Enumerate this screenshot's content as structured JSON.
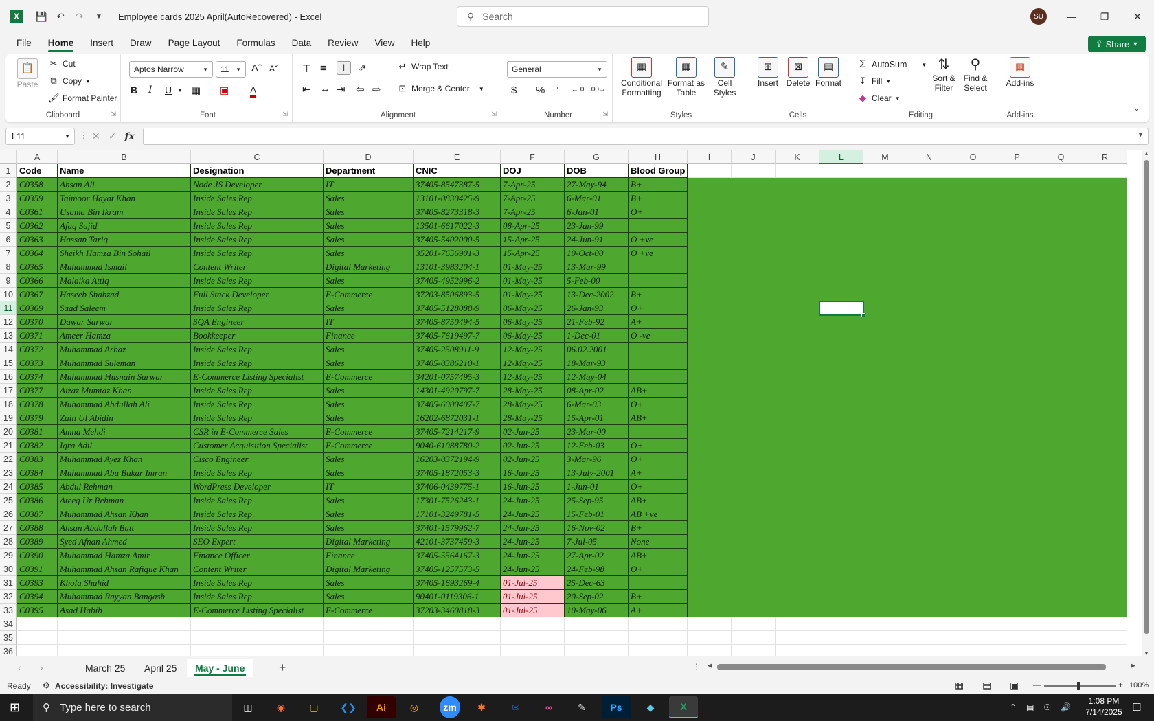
{
  "window": {
    "title": "Employee cards 2025 April(AutoRecovered)  -  Excel",
    "search_placeholder": "Search",
    "user_initials": "SU",
    "share_label": "Share"
  },
  "menu": [
    "File",
    "Home",
    "Insert",
    "Draw",
    "Page Layout",
    "Formulas",
    "Data",
    "Review",
    "View",
    "Help"
  ],
  "ribbon": {
    "clipboard": {
      "label": "Clipboard",
      "paste": "Paste",
      "cut": "Cut",
      "copy": "Copy",
      "format_painter": "Format Painter"
    },
    "font": {
      "label": "Font",
      "name": "Aptos Narrow",
      "size": "11",
      "bold": "B",
      "italic": "I",
      "underline": "U"
    },
    "alignment": {
      "label": "Alignment",
      "wrap": "Wrap Text",
      "merge": "Merge & Center"
    },
    "number": {
      "label": "Number",
      "format": "General"
    },
    "styles": {
      "label": "Styles",
      "conditional": "Conditional Formatting",
      "format_table": "Format as Table",
      "cell_styles": "Cell Styles"
    },
    "cells": {
      "label": "Cells",
      "insert": "Insert",
      "delete": "Delete",
      "format": "Format"
    },
    "editing": {
      "label": "Editing",
      "autosum": "AutoSum",
      "fill": "Fill",
      "clear": "Clear",
      "sort": "Sort & Filter",
      "find": "Find & Select"
    },
    "addins": {
      "label": "Add-ins",
      "addins": "Add-ins"
    }
  },
  "formula_bar": {
    "name_box": "L11",
    "fx": "fx",
    "value": ""
  },
  "columns": [
    "A",
    "B",
    "C",
    "D",
    "E",
    "F",
    "G",
    "H",
    "I",
    "J",
    "K",
    "L",
    "M",
    "N",
    "O",
    "P",
    "Q",
    "R"
  ],
  "headers": [
    "Code",
    "Name",
    "Designation",
    "Department",
    "CNIC",
    "DOJ",
    "DOB",
    "Blood Group"
  ],
  "rows": [
    [
      "C0358",
      "Ahsan Ali",
      "Node JS Developer",
      "IT",
      "37405-8547387-5",
      "7-Apr-25",
      "27-May-94",
      "B+"
    ],
    [
      "C0359",
      "Taimoor Hayat Khan",
      "Inside Sales Rep",
      "Sales",
      "13101-0830425-9",
      "7-Apr-25",
      "6-Mar-01",
      "B+"
    ],
    [
      "C0361",
      "Usama Bin Ikram",
      "Inside Sales Rep",
      "Sales",
      "37405-8273318-3",
      "7-Apr-25",
      "6-Jan-01",
      "O+"
    ],
    [
      "C0362",
      "Afaq Sajid",
      "Inside Sales Rep",
      "Sales",
      "13501-6617022-3",
      "08-Apr-25",
      "23-Jan-99",
      ""
    ],
    [
      "C0363",
      "Hassan Tariq",
      "Inside Sales Rep",
      "Sales",
      "37405-5402000-5",
      "15-Apr-25",
      "24-Jun-91",
      "O +ve"
    ],
    [
      "C0364",
      "Sheikh Hamza Bin Sohail",
      "Inside Sales Rep",
      "Sales",
      "35201-7656901-3",
      "15-Apr-25",
      "10-Oct-00",
      "O +ve"
    ],
    [
      "C0365",
      "Muhammad Ismail",
      "Content Writer",
      "Digital Marketing",
      "13101-3983204-1",
      "01-May-25",
      "13-Mar-99",
      ""
    ],
    [
      "C0366",
      "Malaika Attiq",
      "Inside Sales Rep",
      "Sales",
      "37405-4952996-2",
      "01-May-25",
      "5-Feb-00",
      ""
    ],
    [
      "C0367",
      "Haseeb Shahzad",
      "Full Stack Developer",
      "E-Commerce",
      "37203-8506893-5",
      "01-May-25",
      "13-Dec-2002",
      "B+"
    ],
    [
      "C0369",
      "Saad Saleem",
      "Inside Sales Rep",
      "Sales",
      "37405-5128088-9",
      "06-May-25",
      "26-Jan-93",
      "O+"
    ],
    [
      "C0370",
      "Dawar Sarwar",
      "SQA Engineer",
      "IT",
      "37405-8750494-5",
      "06-May-25",
      "21-Feb-92",
      "A+"
    ],
    [
      "C0371",
      "Ameer Hamza",
      "Bookkeeper",
      "Finance",
      "37405-7619497-7",
      "06-May-25",
      "1-Dec-01",
      "O -ve"
    ],
    [
      "C0372",
      "Muhammad Arbaz",
      "Inside Sales Rep",
      "Sales",
      "37405-2508911-9",
      "12-May-25",
      "06.02.2001",
      ""
    ],
    [
      "C0373",
      "Muhammad Suleman",
      "Inside Sales Rep",
      "Sales",
      "37405-0386210-1",
      "12-May-25",
      "18-Mar-93",
      ""
    ],
    [
      "C0374",
      "Muhammad Husnain Sarwar",
      "E-Commerce Listing Specialist",
      "E-Commerce",
      "34201-0757495-3",
      "12-May-25",
      "12-May-04",
      ""
    ],
    [
      "C0377",
      "Aizaz Mumtaz Khan",
      "Inside Sales Rep",
      "Sales",
      "14301-4920797-7",
      "28-May-25",
      "08-Apr-02",
      "AB+"
    ],
    [
      "C0378",
      "Muhammad Abdullah Ali",
      "Inside Sales Rep",
      "Sales",
      "37405-6000407-7",
      "28-May-25",
      "6-Mar-03",
      "O+"
    ],
    [
      "C0379",
      "Zain Ul Abidin",
      "Inside Sales Rep",
      "Sales",
      "16202-6872031-1",
      "28-May-25",
      "15-Apr-01",
      "AB+"
    ],
    [
      "C0381",
      "Amna Mehdi",
      "CSR in E-Commerce Sales",
      "E-Commerce",
      "37405-7214217-9",
      "02-Jun-25",
      "23-Mar-00",
      ""
    ],
    [
      "C0382",
      "Iqra Adil",
      "Customer Acquisition Specialist",
      "E-Commerce",
      "9040-61088780-2",
      "02-Jun-25",
      "12-Feb-03",
      "O+"
    ],
    [
      "C0383",
      "Muhammad Ayez Khan",
      "Cisco Engineer",
      "Sales",
      "16203-0372194-9",
      "02-Jun-25",
      "3-Mar-96",
      "O+"
    ],
    [
      "C0384",
      "Muhammad Abu Bakar Imran",
      "Inside Sales Rep",
      "Sales",
      "37405-1872053-3",
      "16-Jun-25",
      "13-July-2001",
      "A+"
    ],
    [
      "C0385",
      "Abdul Rehman",
      "WordPress Developer",
      "IT",
      "37406-0439775-1",
      "16-Jun-25",
      "1-Jun-01",
      "O+"
    ],
    [
      "C0386",
      "Ateeq Ur Rehman",
      "Inside Sales Rep",
      "Sales",
      "17301-7526243-1",
      "24-Jun-25",
      "25-Sep-95",
      "AB+"
    ],
    [
      "C0387",
      "Muhammad Ahsan Khan",
      "Inside Sales Rep",
      "Sales",
      "17101-3249781-5",
      "24-Jun-25",
      "15-Feb-01",
      "AB +ve"
    ],
    [
      "C0388",
      "Ahsan Abdullah Butt",
      "Inside Sales Rep",
      "Sales",
      "37401-1579962-7",
      "24-Jun-25",
      "16-Nov-02",
      "B+"
    ],
    [
      "C0389",
      "Syed Afnan Ahmed",
      "SEO Expert",
      "Digital Marketing",
      "42101-3737459-3",
      "24-Jun-25",
      "7-Jul-05",
      "None"
    ],
    [
      "C0390",
      "Muhammad Hamza Amir",
      "Finance Officer",
      "Finance",
      "37405-5564167-3",
      "24-Jun-25",
      "27-Apr-02",
      "AB+"
    ],
    [
      "C0391",
      "Muhammad Ahsan Rafique Khan",
      "Content Writer",
      "Digital Marketing",
      "37405-1257573-5",
      "24-Jun-25",
      "24-Feb-98",
      "O+"
    ],
    [
      "C0393",
      "Khola Shahid",
      "Inside Sales Rep",
      "Sales",
      "37405-1693269-4",
      "01-Jul-25",
      "25-Dec-63",
      ""
    ],
    [
      "C0394",
      "Muhammad Rayyan Bangash",
      "Inside Sales Rep",
      "Sales",
      "90401-0119306-1",
      "01-Jul-25",
      "20-Sep-02",
      "B+"
    ],
    [
      "C0395",
      "Asad Habib",
      "E-Commerce Listing Specialist",
      "E-Commerce",
      "37203-3460818-3",
      "01-Jul-25",
      "10-May-06",
      "A+"
    ]
  ],
  "highlighted_doj_rows": [
    31,
    32,
    33
  ],
  "sheets": [
    "March 25",
    "April 25",
    "May - June"
  ],
  "active_sheet": "May - June",
  "status": {
    "ready": "Ready",
    "accessibility": "Accessibility: Investigate",
    "zoom": "100%"
  },
  "taskbar": {
    "search_placeholder": "Type here to search",
    "time": "1:08 PM",
    "date": "7/14/2025"
  },
  "colors": {
    "accent": "#107c41",
    "data_fill": "#4ea72e",
    "highlight": "#ffc7ce"
  }
}
